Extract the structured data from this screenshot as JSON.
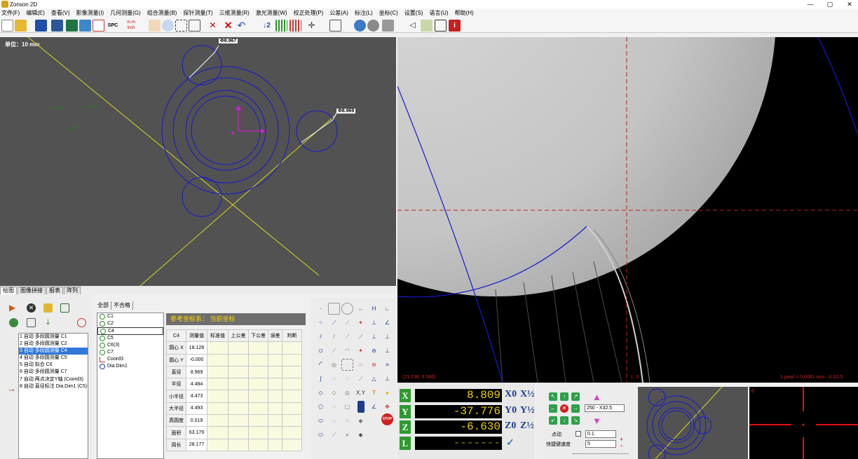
{
  "app": {
    "title": "Zonson 2D"
  },
  "window_controls": {
    "minimize": "—",
    "maximize": "▢",
    "close": "✕"
  },
  "menu": [
    "文件(F)",
    "编辑(E)",
    "查看(V)",
    "影像测量(I)",
    "几何测量(G)",
    "组合测量(B)",
    "探针测量(T)",
    "三维测量(R)",
    "激光测量(W)",
    "校正处理(P)",
    "公差(A)",
    "标注(L)",
    "坐标(C)",
    "设置(S)",
    "语言(U)",
    "帮助(H)"
  ],
  "toolbar": {
    "spc_label": "SPC",
    "mm_label": "m.m",
    "inch_label": "inch"
  },
  "cad": {
    "unit_label": "单位：",
    "unit_value": "10 mm",
    "dim1_label": "Φ8.967",
    "dim2_label": "Φ8.969"
  },
  "view_tabs": [
    "绘图",
    "图像拼接",
    "报表",
    "阵列"
  ],
  "features": [
    "1 自动 多段圆测量 C1",
    "2 自动 多段圆测量 C2",
    "3 自动 多段圆测量 C4",
    "4 自动 多段圆测量 C5",
    "5 自动 拟合 C6",
    "6 自动 多段圆测量 C7",
    "7 自动 两点决定Y轴 (Coord3)",
    "8 自动 直径标注 Dia.Dim1 (C5)"
  ],
  "feature_selected_index": 2,
  "arrow_marker": "→",
  "table_tabs": [
    "全部",
    "不合格"
  ],
  "elements": [
    "C1",
    "C2",
    "C4",
    "C5",
    "C6(3)",
    "C7",
    "Coord3",
    "Dia.Dim1"
  ],
  "element_selected_index": 2,
  "coord_header": {
    "label": "参考坐标系：",
    "value": "当前坐标"
  },
  "result_table": {
    "headers": [
      "C4",
      "测量值",
      "标准值",
      "上公差",
      "下公差",
      "误差",
      "判断"
    ],
    "rows": [
      [
        "圆心 X",
        "18.128"
      ],
      [
        "圆心 Y",
        "-0.000"
      ],
      [
        "直径",
        "8.969"
      ],
      [
        "半径",
        "4.484"
      ],
      [
        "小半径",
        "4.473"
      ],
      [
        "大半径",
        "4.493"
      ],
      [
        "真圆度",
        "0.019"
      ],
      [
        "面积",
        "63.179"
      ],
      [
        "周长",
        "28.177"
      ]
    ]
  },
  "tool_text": {
    "xy": "X.Y",
    "text": "T",
    "stop": "STOP"
  },
  "camera": {
    "coord_readout": "(21.236, 3.566)",
    "l_readout": "L: 0",
    "pixel_readout": "1 pixel = 0.0061 mm   X 32.5"
  },
  "dro": {
    "axes": [
      {
        "label": "X",
        "value": "8.809",
        "zero": "X0",
        "half": "X½"
      },
      {
        "label": "Y",
        "value": "-37.776",
        "zero": "Y0",
        "half": "Y½"
      },
      {
        "label": "Z",
        "value": "-6.630",
        "zero": "Z0",
        "half": "Z½"
      },
      {
        "label": "L",
        "value": "-------",
        "zero": "✓",
        "half": ""
      }
    ]
  },
  "jog": {
    "zoom_option": "250 - X32.5",
    "step_label": "点动",
    "step_value": "0.1",
    "speed_label": "快捷键速度",
    "speed_value": "5",
    "plus": "+",
    "minus": "−"
  },
  "mini2_label": "5",
  "colors": {
    "accent_yellow": "#f0d000",
    "axis_green": "#2e9a2e",
    "selection_blue": "#3178d8",
    "cad_bg": "#525252"
  }
}
